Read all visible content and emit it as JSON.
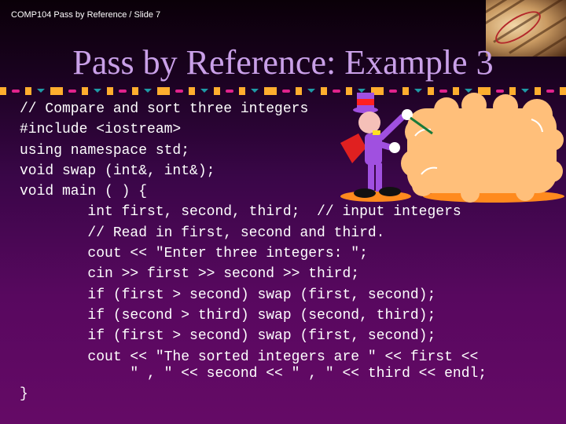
{
  "slide": {
    "header_label": "COMP104 Pass by Reference / Slide 7",
    "title": "Pass by Reference: Example 3",
    "decoration_icons": [
      "dictionary-reference-image",
      "magician-clipart-icon",
      "cloud-icon"
    ],
    "colors": {
      "title": "#c9a0e8",
      "deco_orange": "#ffae2e",
      "deco_pink": "#e0238c",
      "deco_teal": "#1e9aa6",
      "code_text": "#ffffff"
    }
  },
  "code_lines": [
    {
      "indent": 0,
      "text": "// Compare and sort three integers"
    },
    {
      "indent": 0,
      "text": "#include <iostream>"
    },
    {
      "indent": 0,
      "text": "using namespace std;"
    },
    {
      "indent": 0,
      "text": "void swap (int&, int&);"
    },
    {
      "indent": 0,
      "text": "void main ( ) {"
    },
    {
      "indent": 1,
      "text": "int first, second, third;  // input integers"
    },
    {
      "indent": 1,
      "text": "// Read in first, second and third."
    },
    {
      "indent": 1,
      "text": "cout << \"Enter three integers: \";"
    },
    {
      "indent": 1,
      "text": "cin >> first >> second >> third;"
    },
    {
      "indent": 1,
      "text": "if (first > second) swap (first, second);"
    },
    {
      "indent": 1,
      "text": "if (second > third) swap (second, third);"
    },
    {
      "indent": 1,
      "text": "if (first > second) swap (first, second);"
    },
    {
      "indent": 1,
      "text": "cout << \"The sorted integers are \" << first <<"
    },
    {
      "indent": 2,
      "text": "\" , \" << second << \" , \" << third << endl;"
    },
    {
      "indent": 0,
      "text": "}"
    }
  ]
}
